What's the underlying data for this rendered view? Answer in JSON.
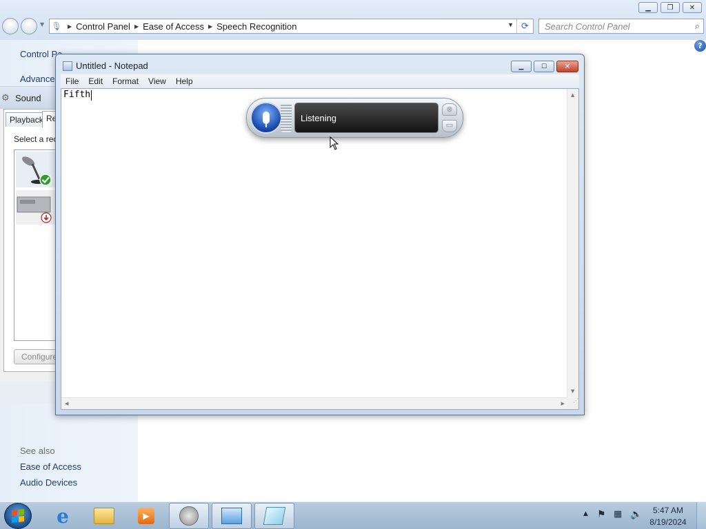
{
  "control_panel": {
    "breadcrumbs": [
      "Control Panel",
      "Ease of Access",
      "Speech Recognition"
    ],
    "search_placeholder": "Search Control Panel",
    "left_pane": {
      "home_link": "Control Pa",
      "advanced_link": "Advanced",
      "see_also": "See also",
      "links": [
        "Ease of Access",
        "Audio Devices"
      ]
    }
  },
  "sound_dialog": {
    "title": "Sound",
    "tabs": [
      "Playback",
      "Re"
    ],
    "instruction": "Select a rec",
    "configure_label": "Configure"
  },
  "notepad": {
    "title": "Untitled - Notepad",
    "menu": [
      "File",
      "Edit",
      "Format",
      "View",
      "Help"
    ],
    "content": "Fifth"
  },
  "speech_recognition": {
    "status": "Listening"
  },
  "taskbar": {
    "pinned": [
      "internet-explorer",
      "windows-explorer",
      "windows-media-player",
      "sound",
      "control-panel",
      "notepad"
    ],
    "clock": {
      "time": "5:47 AM",
      "date": "8/19/2024"
    }
  },
  "colors": {
    "title_gradient_top": "#dde8f5",
    "speech_display": "#141414",
    "mic_button": "#1445a8",
    "notepad_close": "#c2432b",
    "taskbar": "#9cb6cf"
  }
}
